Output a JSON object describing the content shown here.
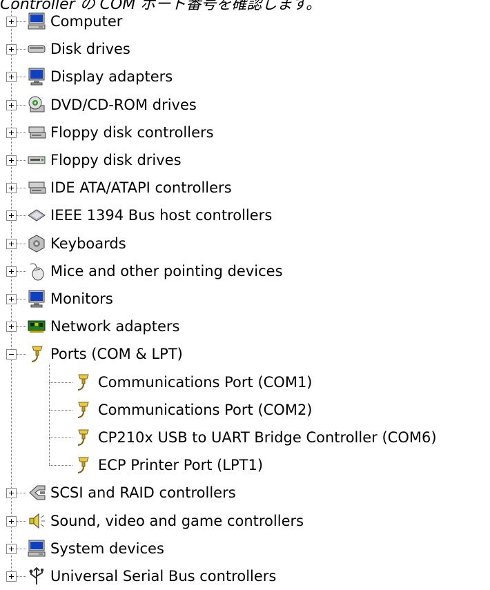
{
  "caption": "Controller の COM ポート番号を確認します。",
  "tree": {
    "items": [
      {
        "label": "Computer",
        "icon": "computer-icon",
        "expander": "plus"
      },
      {
        "label": "Disk drives",
        "icon": "disk-drive-icon",
        "expander": "plus"
      },
      {
        "label": "Display adapters",
        "icon": "display-adapter-icon",
        "expander": "plus"
      },
      {
        "label": "DVD/CD-ROM drives",
        "icon": "dvd-drive-icon",
        "expander": "plus"
      },
      {
        "label": "Floppy disk controllers",
        "icon": "floppy-controller-icon",
        "expander": "plus"
      },
      {
        "label": "Floppy disk drives",
        "icon": "floppy-drive-icon",
        "expander": "plus"
      },
      {
        "label": "IDE ATA/ATAPI controllers",
        "icon": "ide-controller-icon",
        "expander": "plus"
      },
      {
        "label": "IEEE 1394 Bus host controllers",
        "icon": "ieee1394-icon",
        "expander": "plus"
      },
      {
        "label": "Keyboards",
        "icon": "keyboard-icon",
        "expander": "plus"
      },
      {
        "label": "Mice and other pointing devices",
        "icon": "mouse-icon",
        "expander": "plus"
      },
      {
        "label": "Monitors",
        "icon": "monitor-icon",
        "expander": "plus"
      },
      {
        "label": "Network adapters",
        "icon": "network-adapter-icon",
        "expander": "plus"
      },
      {
        "label": "Ports (COM & LPT)",
        "icon": "port-icon",
        "expander": "minus",
        "children": [
          {
            "label": "Communications Port (COM1)",
            "icon": "port-icon"
          },
          {
            "label": "Communications Port (COM2)",
            "icon": "port-icon"
          },
          {
            "label": "CP210x USB to UART Bridge Controller (COM6)",
            "icon": "port-icon"
          },
          {
            "label": "ECP Printer Port (LPT1)",
            "icon": "port-icon"
          }
        ]
      },
      {
        "label": "SCSI and RAID controllers",
        "icon": "scsi-controller-icon",
        "expander": "plus"
      },
      {
        "label": "Sound, video and game controllers",
        "icon": "sound-icon",
        "expander": "plus"
      },
      {
        "label": "System devices",
        "icon": "system-devices-icon",
        "expander": "plus"
      },
      {
        "label": "Universal Serial Bus controllers",
        "icon": "usb-icon",
        "expander": "plus"
      }
    ]
  }
}
